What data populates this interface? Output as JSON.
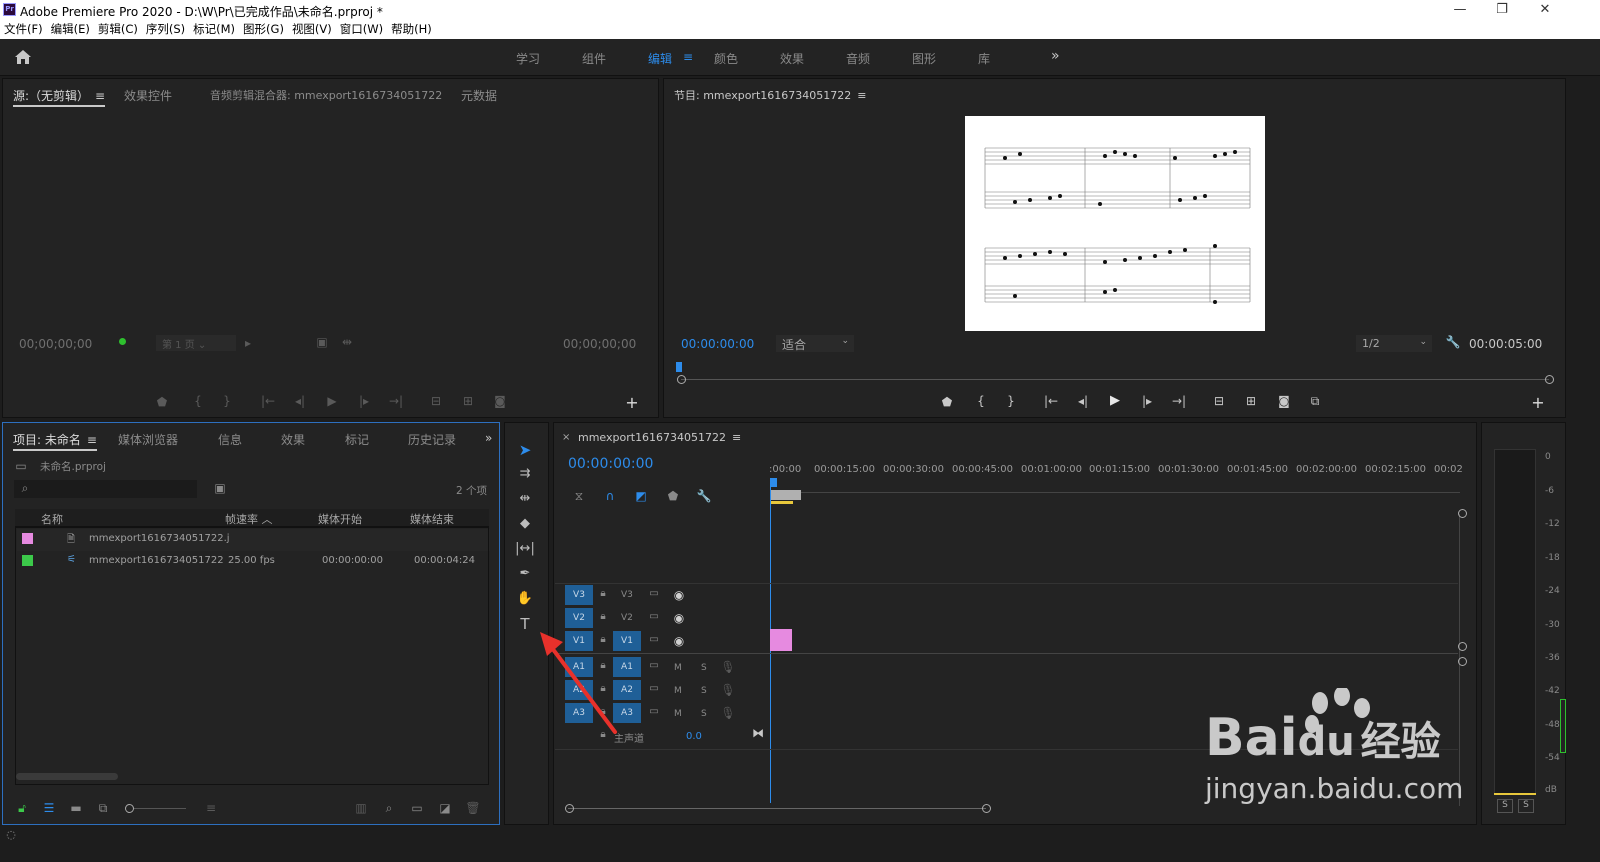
{
  "titlebar": {
    "logo": "Pr",
    "title": "Adobe Premiere Pro 2020 - D:\\W\\Pr\\已完成作品\\未命名.prproj *",
    "minimize": "—",
    "restore": "❐",
    "close": "✕"
  },
  "menu": [
    "文件(F)",
    "编辑(E)",
    "剪辑(C)",
    "序列(S)",
    "标记(M)",
    "图形(G)",
    "视图(V)",
    "窗口(W)",
    "帮助(H)"
  ],
  "workspaces": {
    "items": [
      "学习",
      "组件",
      "编辑",
      "颜色",
      "效果",
      "音频",
      "图形",
      "库"
    ],
    "active": "编辑",
    "more": "»"
  },
  "source_panel": {
    "tabs": [
      "源:（无剪辑）",
      "效果控件",
      "音频剪辑混合器: mmexport1616734051722",
      "元数据"
    ],
    "timecode_in": "00;00;00;00",
    "timecode_out": "00;00;00;00",
    "page_select": "第 1 页"
  },
  "program_panel": {
    "tab": "节目: mmexport1616734051722",
    "timecode": "00:00:00:00",
    "fit": "适合",
    "resolution": "1/2",
    "duration": "00:00:05:00"
  },
  "project_panel": {
    "tabs": [
      "项目: 未命名",
      "媒体浏览器",
      "信息",
      "效果",
      "标记",
      "历史记录"
    ],
    "file": "未命名.prproj",
    "item_count": "2 个项",
    "search_placeholder": "",
    "columns": [
      "名称",
      "帧速率",
      "媒体开始",
      "媒体结束"
    ],
    "rows": [
      {
        "color": "#e68ae0",
        "name": "mmexport1616734051722.j",
        "fps": "",
        "start": "",
        "end": ""
      },
      {
        "color": "#3cc94a",
        "name": "mmexport1616734051722",
        "fps": "25.00 fps",
        "start": "00:00:00:00",
        "end": "00:00:04:24"
      }
    ]
  },
  "timeline": {
    "sequence": "mmexport1616734051722",
    "timecode": "00:00:00:00",
    "ruler": [
      ":00:00",
      "00:00:15:00",
      "00:00:30:00",
      "00:00:45:00",
      "00:01:00:00",
      "00:01:15:00",
      "00:01:30:00",
      "00:01:45:00",
      "00:02:00:00",
      "00:02:15:00",
      "00:02"
    ],
    "video_tracks": [
      "V3",
      "V2",
      "V1"
    ],
    "audio_tracks": [
      "A1",
      "A2",
      "A3"
    ],
    "mute": "M",
    "solo": "S",
    "master": "主声道",
    "master_value": "0.0"
  },
  "meter": {
    "labels": [
      "0",
      "-6",
      "-12",
      "-18",
      "-24",
      "-30",
      "-36",
      "-42",
      "-48",
      "-54",
      "dB"
    ],
    "solo_left": "S",
    "solo_right": "S"
  },
  "watermark": {
    "brand": "Bai",
    "brand2": "du",
    "cn": "经验",
    "url": "jingyan.baidu.com"
  }
}
